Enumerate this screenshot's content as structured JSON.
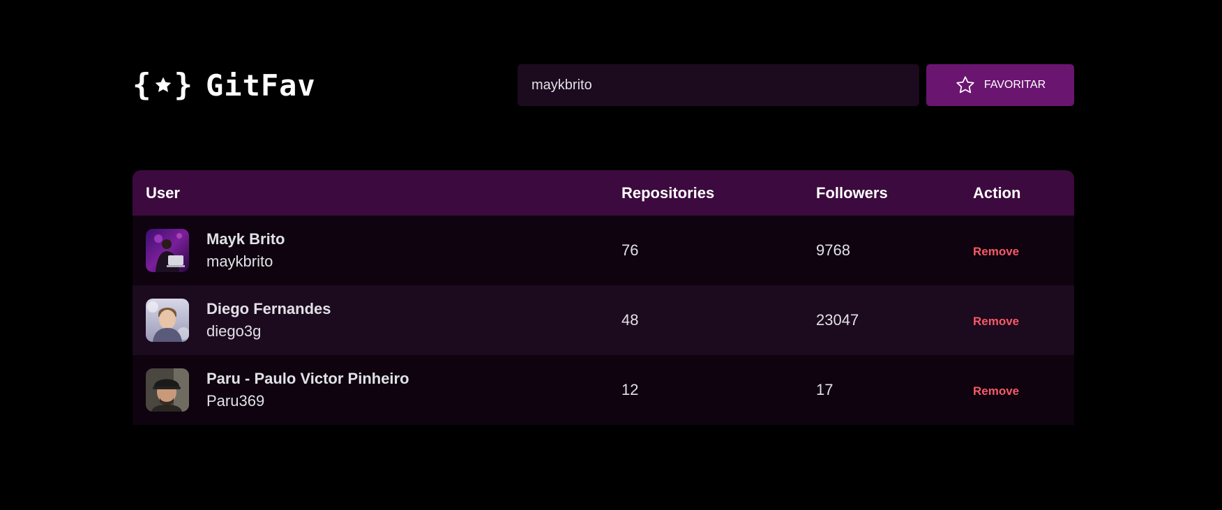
{
  "header": {
    "logo_text": "GitFav",
    "search_value": "maykbrito",
    "favorite_label": "FAVORITAR"
  },
  "table": {
    "columns": {
      "user": "User",
      "repositories": "Repositories",
      "followers": "Followers",
      "action": "Action"
    },
    "rows": [
      {
        "name": "Mayk Brito",
        "login": "maykbrito",
        "repositories": "76",
        "followers": "9768",
        "action": "Remove"
      },
      {
        "name": "Diego Fernandes",
        "login": "diego3g",
        "repositories": "48",
        "followers": "23047",
        "action": "Remove"
      },
      {
        "name": "Paru - Paulo Victor Pinheiro",
        "login": "Paru369",
        "repositories": "12",
        "followers": "17",
        "action": "Remove"
      }
    ]
  },
  "colors": {
    "background": "#000000",
    "input_background": "#1c0a1e",
    "accent": "#6a1570",
    "table_header": "#3c0a3e",
    "row_odd": "#0e030f",
    "row_even": "#1c0a1e",
    "remove": "#f75a68"
  },
  "icons": {
    "logo": "star-icon",
    "button": "star-outline-icon"
  }
}
